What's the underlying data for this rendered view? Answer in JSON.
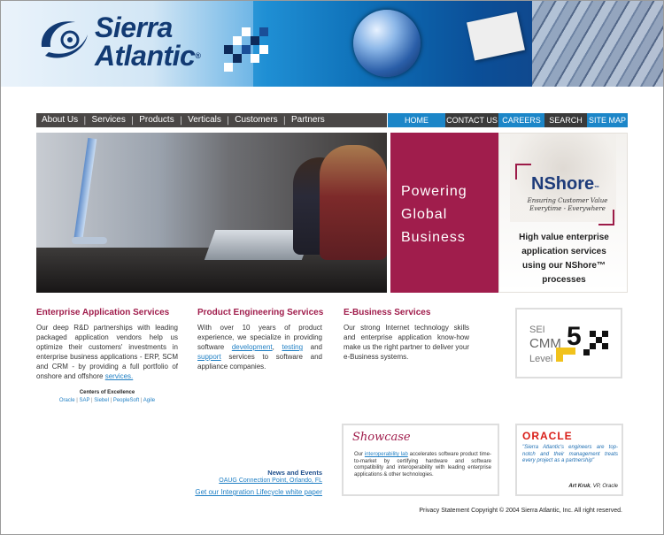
{
  "header": {
    "logo_line1": "Sierra",
    "logo_line2": "Atlantic",
    "logo_registered": "®"
  },
  "nav_left": [
    "About Us",
    "Services",
    "Products",
    "Verticals",
    "Customers",
    "Partners"
  ],
  "nav_right": [
    "HOME",
    "CONTACT US",
    "CAREERS",
    "SEARCH",
    "SITE MAP"
  ],
  "hero": {
    "powering_lines": [
      "Powering",
      "Global",
      "Business"
    ],
    "nshore_logo": "NShore",
    "nshore_tm": "™",
    "nshore_tagline": [
      "Ensuring Customer Value",
      "Everytime - Everywhere"
    ],
    "nshore_desc_lines": [
      "High value enterprise",
      "application services",
      "using our NShore™",
      "processes"
    ]
  },
  "columns": {
    "enterprise": {
      "title": "Enterprise Application Services",
      "text": "Our deep R&D partnerships with leading packaged application vendors help us optimize their customers' investments in enterprise business applications - ERP, SCM and CRM - by providing a full portfolio of onshore and offshore",
      "link": "services."
    },
    "product": {
      "title": "Product Engineering Services",
      "text1": "With over 10 years of product experience, we specialize in providing software",
      "link1": "development",
      "sep1": ", ",
      "link2": "testing",
      "and": " and ",
      "link3": "support",
      "text2": " services to software and appliance companies."
    },
    "ebusiness": {
      "title": "E-Business Services",
      "text": "Our strong Internet technology skills and enterprise application know-how make us the right partner to deliver your e-Business systems."
    }
  },
  "centers": {
    "heading": "Centers of Excellence",
    "items": [
      "Oracle",
      "SAP",
      "Siebel",
      "PeopleSoft",
      "Agile"
    ]
  },
  "cmm": {
    "sei": "SEI",
    "cmm": "CMM",
    "level_word": "Level",
    "level_num": "5"
  },
  "news": {
    "heading": "News and Events",
    "link": "OAUG Connection Point, Orlando, FL",
    "whitepaper": "Get our Integration Lifecycle white paper"
  },
  "showcase": {
    "title": "Showcase",
    "pre": "Our ",
    "link": "interoperability lab",
    "text": " accelerates software product time-to-market by certifying hardware and software compatibility and interoperability with leading enterprise applications & other technologies."
  },
  "oracle": {
    "logo": "ORACLE",
    "quote": "\"Sierra Atlantic's engineers are top-notch and their management treats every project as a partnership\"",
    "author": "Art Kruk",
    "role": ", VP, Oracle"
  },
  "footer": {
    "privacy": "Privacy Statement",
    "copyright": "Copyright © 2004 Sierra Atlantic, Inc. All right reserved."
  },
  "colors": {
    "brand_blue": "#1c86c8",
    "brand_maroon": "#a01d4c",
    "nav_dark": "#4a4746"
  }
}
